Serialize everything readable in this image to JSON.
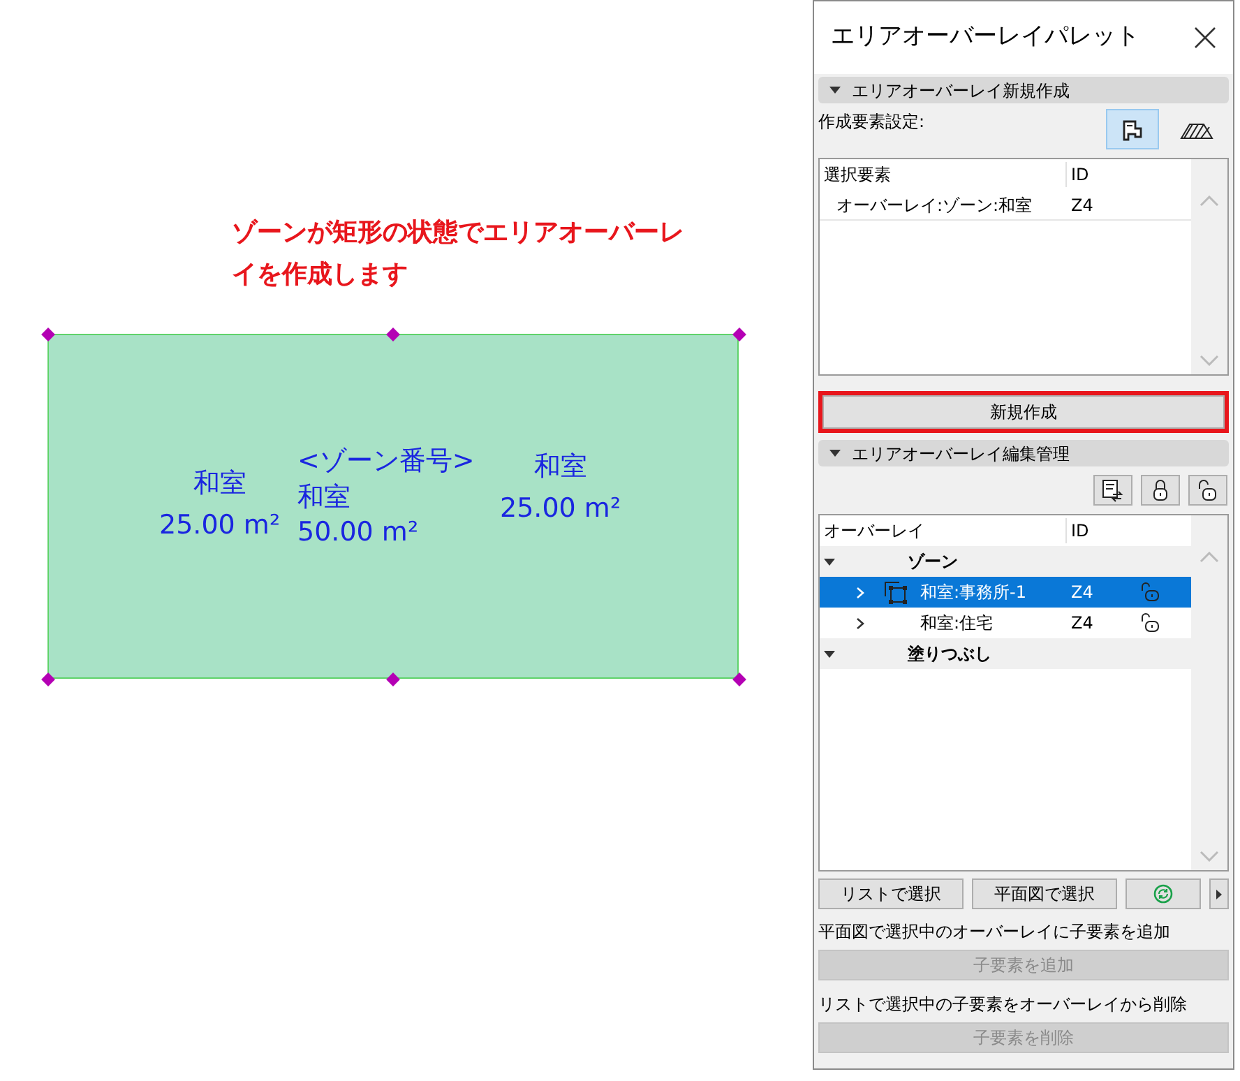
{
  "annotation": {
    "text": "ゾーンが矩形の状態でエリアオーバーレイを作成します"
  },
  "zone": {
    "stamps": [
      {
        "lines": [
          "和室",
          "25.00 m²"
        ]
      },
      {
        "lines": [
          "<ゾーン番号>",
          "和室",
          "50.00 m²"
        ]
      },
      {
        "lines": [
          "和室",
          "25.00 m²"
        ]
      }
    ]
  },
  "palette": {
    "title": "エリアオーバーレイパレット",
    "create_section": {
      "header": "エリアオーバーレイ新規作成",
      "expanded": true,
      "label": "作成要素設定:",
      "tools": [
        {
          "kind": "zone",
          "selected": true
        },
        {
          "kind": "fill",
          "selected": false
        }
      ],
      "table": {
        "columns": [
          "選択要素",
          "ID"
        ],
        "rows": [
          {
            "name": "オーバーレイ:ゾーン:和室",
            "id": "Z4"
          }
        ]
      },
      "create_button": {
        "label": "新規作成",
        "highlighted": true
      }
    },
    "edit_section": {
      "header": "エリアオーバーレイ編集管理",
      "expanded": true,
      "tools": [
        {
          "kind": "swap"
        },
        {
          "kind": "lock"
        },
        {
          "kind": "unlock"
        }
      ],
      "table": {
        "columns": [
          "オーバーレイ",
          "ID"
        ],
        "groups": [
          {
            "label": "ゾーン",
            "expanded": true,
            "children": [
              {
                "label": "和室:事務所-1",
                "id": "Z4",
                "selected": true,
                "has_icon": true,
                "locked": false
              },
              {
                "label": "和室:住宅",
                "id": "Z4",
                "selected": false,
                "has_icon": false,
                "locked": false
              }
            ]
          },
          {
            "label": "塗りつぶし",
            "expanded": true
          }
        ]
      },
      "select_buttons": [
        {
          "kind": "text",
          "label": "リストで選択"
        },
        {
          "kind": "text",
          "label": "平面図で選択"
        },
        {
          "kind": "refresh"
        },
        {
          "kind": "more"
        }
      ],
      "add_hint": "平面図で選択中のオーバーレイに子要素を追加",
      "add_button": {
        "label": "子要素を追加",
        "disabled": true
      },
      "remove_hint": "リストで選択中の子要素をオーバーレイから削除",
      "remove_button": {
        "label": "子要素を削除",
        "disabled": true
      }
    }
  }
}
